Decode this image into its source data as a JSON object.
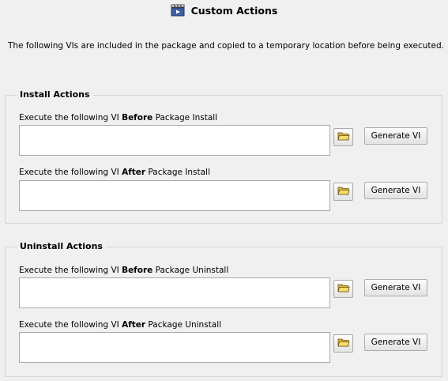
{
  "header": {
    "title": "Custom Actions",
    "icon": "clapperboard-icon"
  },
  "description": "The following VIs are included in the package and copied to a temporary location before being executed.",
  "install": {
    "title": "Install Actions",
    "before": {
      "label_prefix": "Execute the following VI ",
      "label_bold": "Before",
      "label_suffix": " Package Install",
      "value": "",
      "generate_label": "Generate VI"
    },
    "after": {
      "label_prefix": "Execute the following VI ",
      "label_bold": "After",
      "label_suffix": " Package Install",
      "value": "",
      "generate_label": "Generate VI"
    }
  },
  "uninstall": {
    "title": "Uninstall Actions",
    "before": {
      "label_prefix": "Execute the following VI ",
      "label_bold": "Before",
      "label_suffix": " Package Uninstall",
      "value": "",
      "generate_label": "Generate VI"
    },
    "after": {
      "label_prefix": "Execute the following VI ",
      "label_bold": "After",
      "label_suffix": " Package Uninstall",
      "value": "",
      "generate_label": "Generate VI"
    }
  },
  "colors": {
    "background": "#f0f0f0",
    "folder_icon": "#e8c84a"
  }
}
